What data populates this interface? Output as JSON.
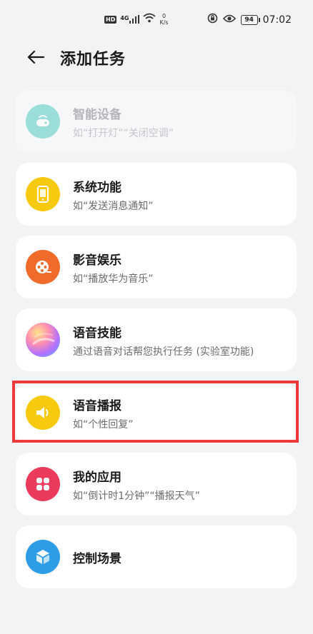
{
  "status_bar": {
    "hd": "HD",
    "signal_type": "4G",
    "net_speed_value": "0",
    "net_speed_unit": "K/s",
    "battery": "94",
    "time": "07:02"
  },
  "header": {
    "title": "添加任务"
  },
  "tasks": [
    {
      "title": "智能设备",
      "subtitle": "如“打开灯”“关闭空调”",
      "icon": "smart-device-icon",
      "color": "#2ec2b4",
      "enabled": false
    },
    {
      "title": "系统功能",
      "subtitle": "如“发送消息通知”",
      "icon": "tablet-icon",
      "color": "#f7c90f",
      "enabled": true
    },
    {
      "title": "影音娱乐",
      "subtitle": "如“播放华为音乐”",
      "icon": "film-reel-icon",
      "color": "#f06a2a",
      "enabled": true
    },
    {
      "title": "语音技能",
      "subtitle": "通过语音对话帮您执行任务 (实验室功能)",
      "icon": "voice-assistant-orb-icon",
      "color": "#b070ff",
      "enabled": true
    },
    {
      "title": "语音播报",
      "subtitle": "如“个性回复”",
      "icon": "speaker-icon",
      "color": "#f7c90f",
      "enabled": true
    },
    {
      "title": "我的应用",
      "subtitle": "如“倒计时1分钟”“播报天气”",
      "icon": "apps-grid-icon",
      "color": "#ec3a5c",
      "enabled": true
    },
    {
      "title": "控制场景",
      "subtitle": "",
      "icon": "cube-icon",
      "color": "#2d9de8",
      "enabled": true
    }
  ],
  "highlight_color": "#ee3a3a"
}
